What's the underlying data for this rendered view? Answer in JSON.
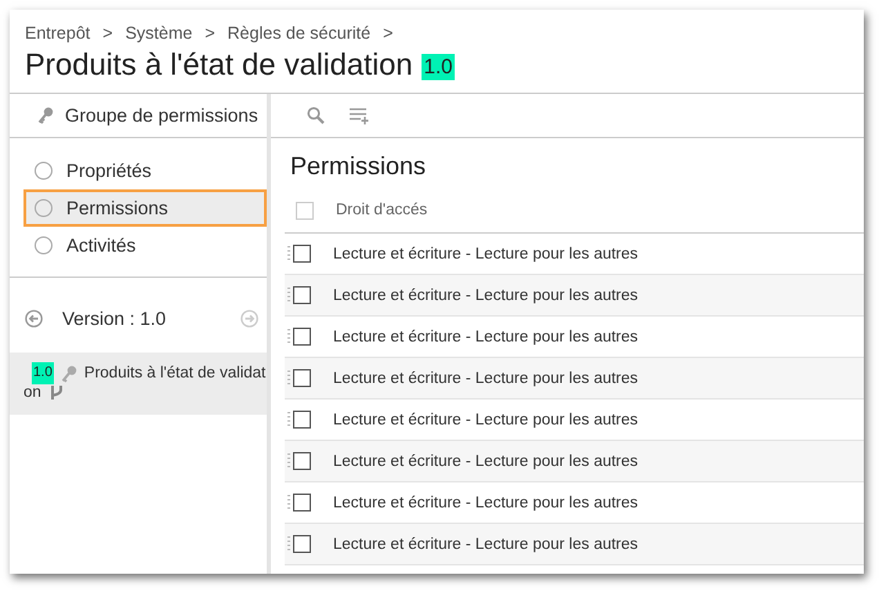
{
  "breadcrumb": [
    "Entrepôt",
    "Système",
    "Règles de sécurité"
  ],
  "breadcrumb_separator": ">",
  "title": "Produits à l'état de validation",
  "title_badge": "1.0",
  "sidebar": {
    "header": "Groupe de permissions",
    "items": [
      {
        "label": "Propriétés",
        "selected": false
      },
      {
        "label": "Permissions",
        "selected": true
      },
      {
        "label": "Activités",
        "selected": false
      }
    ],
    "version": "Version : 1.0",
    "version_card": {
      "badge": "1.0",
      "lines": [
        "Produits à l'état de validat",
        "on"
      ]
    }
  },
  "panel": {
    "heading": "Permissions",
    "column": "Droit d'accés",
    "header_checked": false,
    "rows": [
      {
        "label": "Lecture et écriture - Lecture pour les autres",
        "checked": false
      },
      {
        "label": "Lecture et écriture - Lecture pour les autres",
        "checked": false
      },
      {
        "label": "Lecture et écriture - Lecture pour les autres",
        "checked": false
      },
      {
        "label": "Lecture et écriture - Lecture pour les autres",
        "checked": false
      },
      {
        "label": "Lecture et écriture - Lecture pour les autres",
        "checked": false
      },
      {
        "label": "Lecture et écriture - Lecture pour les autres",
        "checked": false
      },
      {
        "label": "Lecture et écriture - Lecture pour les autres",
        "checked": false
      },
      {
        "label": "Lecture et écriture - Lecture pour les autres",
        "checked": false
      }
    ]
  }
}
